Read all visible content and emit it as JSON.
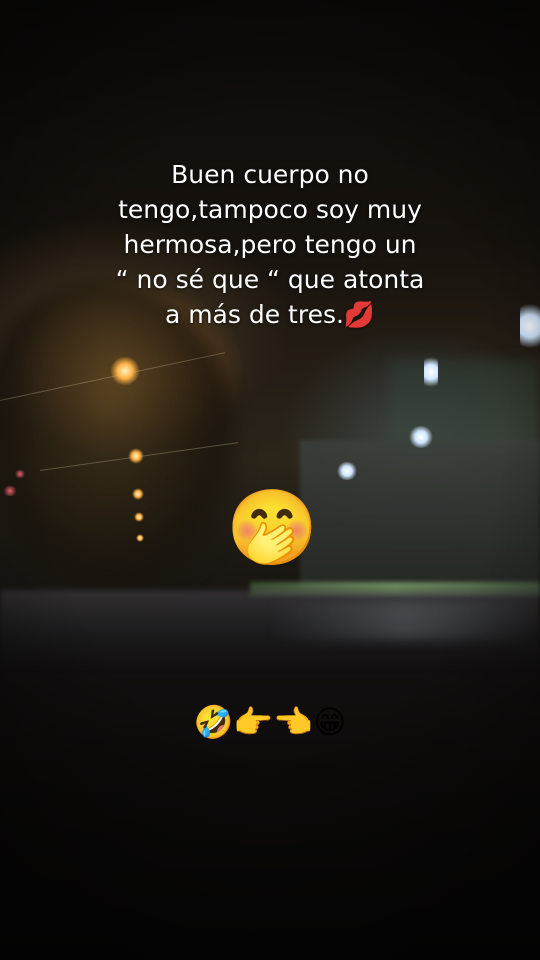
{
  "caption": {
    "line1": "Buen cuerpo no",
    "line2": "tengo,tampoco soy muy",
    "line3": "hermosa,pero tengo un",
    "line4": "“ no sé que “ que atonta",
    "line5": "a más de tres.💋"
  },
  "sticker_emoji": "🤭",
  "emoji_row": "🤣👉👈😁",
  "colors": {
    "caption_text": "#ffffff",
    "streetlight_warm": "#ffb347",
    "streetlight_cool": "#cfe6ff"
  },
  "background_icon": "night-street-photo"
}
